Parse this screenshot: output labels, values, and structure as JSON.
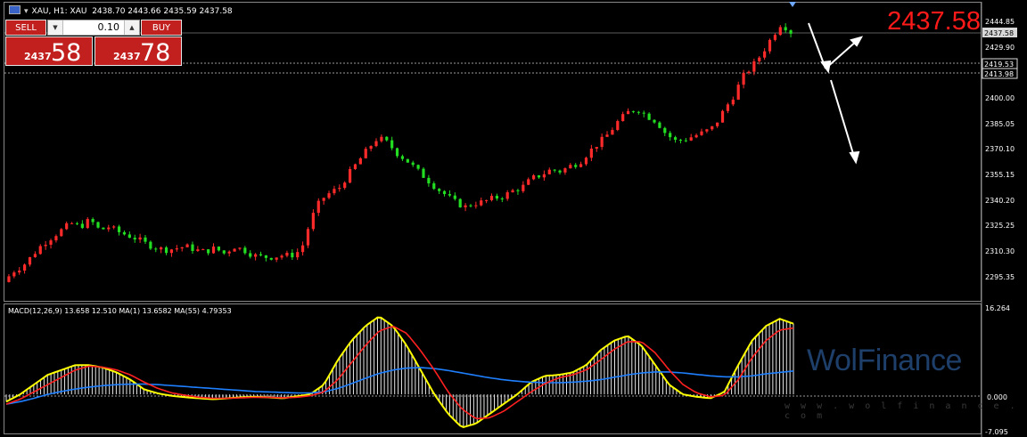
{
  "header": {
    "symbol_text": "XAU, H1:  XAU",
    "ohlc": "2438.70 2443.66 2435.59 2437.58"
  },
  "trade_panel": {
    "sell_label": "SELL",
    "buy_label": "BUY",
    "volume": "0.10",
    "sell_small": "2437",
    "sell_big": "58",
    "buy_small": "2437",
    "buy_big": "78"
  },
  "price_big": "2437.58",
  "price_axis": {
    "ticks": [
      "2444.85",
      "2429.90",
      "2400.00",
      "2385.05",
      "2370.10",
      "2355.15",
      "2340.20",
      "2325.25",
      "2310.30",
      "2295.35"
    ],
    "current": "2437.58",
    "level_1": "2419.53",
    "level_2": "2413.98"
  },
  "macd": {
    "label": "MACD(12,26,9) 13.658 12.510 MA(1) 13.6582 MA(55) 4.79353",
    "ticks": [
      "16.264",
      "0.000",
      "-7.095"
    ]
  },
  "watermark": {
    "brand": "WolFinance",
    "url": "w w w . w o l f i n a n c e . c o m"
  },
  "colors": {
    "bull": "#ff2a2a",
    "bear": "#22dd22",
    "signal": "#ff2020",
    "histogram_outline": "#ffff00",
    "ma55": "#1e7fff",
    "accent_red": "#c21f1f"
  },
  "chart_data": {
    "type": "candlestick",
    "timeframe": "H1",
    "y_range": [
      2288,
      2452
    ],
    "close_path": [
      2297,
      2303,
      2306,
      2312,
      2318,
      2322,
      2326,
      2330,
      2328,
      2332,
      2326,
      2328,
      2325,
      2323,
      2321,
      2318,
      2316,
      2315,
      2316,
      2317,
      2315,
      2314,
      2316,
      2313,
      2317,
      2315,
      2312,
      2311,
      2311,
      2312,
      2312,
      2315,
      2332,
      2343,
      2347,
      2350,
      2358,
      2365,
      2372,
      2378,
      2375,
      2369,
      2365,
      2360,
      2355,
      2350,
      2346,
      2342,
      2339,
      2341,
      2342,
      2344,
      2345,
      2348,
      2350,
      2355,
      2357,
      2360,
      2359,
      2362,
      2364,
      2370,
      2375,
      2380,
      2387,
      2392,
      2394,
      2390,
      2387,
      2380,
      2376,
      2377,
      2379,
      2381,
      2384,
      2393,
      2401,
      2412,
      2418,
      2425,
      2434,
      2442,
      2437
    ],
    "macd": {
      "y_range": [
        -7.095,
        16.264
      ],
      "histogram": [
        -1.5,
        0,
        2,
        4,
        5,
        6,
        6,
        5.5,
        4.5,
        3,
        1,
        0.2,
        -0.3,
        -0.6,
        -0.8,
        -1,
        -0.8,
        -0.6,
        -0.5,
        -0.6,
        -0.8,
        -0.4,
        0,
        2,
        7,
        11,
        14,
        16,
        14,
        10,
        5,
        0,
        -4,
        -6.8,
        -6,
        -4,
        -2,
        0,
        2.5,
        3.8,
        4,
        4.5,
        6,
        9,
        11,
        12,
        10,
        6,
        2,
        0,
        -0.5,
        -0.8,
        0.5,
        6,
        11,
        14,
        15.5,
        14.5
      ],
      "signal": [
        -2,
        -1,
        0.5,
        2,
        3.5,
        5,
        5.8,
        5.6,
        5,
        4,
        2.5,
        1.2,
        0.3,
        -0.2,
        -0.6,
        -0.8,
        -0.8,
        -0.7,
        -0.6,
        -0.6,
        -0.7,
        -0.6,
        -0.3,
        0.5,
        3,
        6.5,
        10,
        13,
        14,
        12.5,
        9,
        5,
        0.5,
        -3,
        -5,
        -4.8,
        -3.5,
        -1.5,
        0.5,
        2.2,
        3.4,
        4,
        5,
        7,
        9.2,
        10.8,
        10.8,
        8.5,
        5,
        2,
        0.3,
        -0.5,
        -0.2,
        3,
        7.5,
        11,
        13.2,
        13.6
      ],
      "ma55": [
        -2,
        -1.5,
        -0.8,
        0,
        0.6,
        1.1,
        1.5,
        1.8,
        2,
        2.1,
        2.1,
        2,
        1.8,
        1.6,
        1.4,
        1.2,
        1,
        0.8,
        0.6,
        0.5,
        0.4,
        0.3,
        0.3,
        0.5,
        1.2,
        2.2,
        3.3,
        4.3,
        5,
        5.4,
        5.5,
        5.3,
        4.9,
        4.4,
        3.9,
        3.4,
        3,
        2.7,
        2.5,
        2.4,
        2.4,
        2.5,
        2.7,
        3,
        3.5,
        4,
        4.4,
        4.6,
        4.6,
        4.4,
        4.1,
        3.8,
        3.6,
        3.6,
        3.8,
        4.2,
        4.5,
        4.8
      ]
    }
  }
}
